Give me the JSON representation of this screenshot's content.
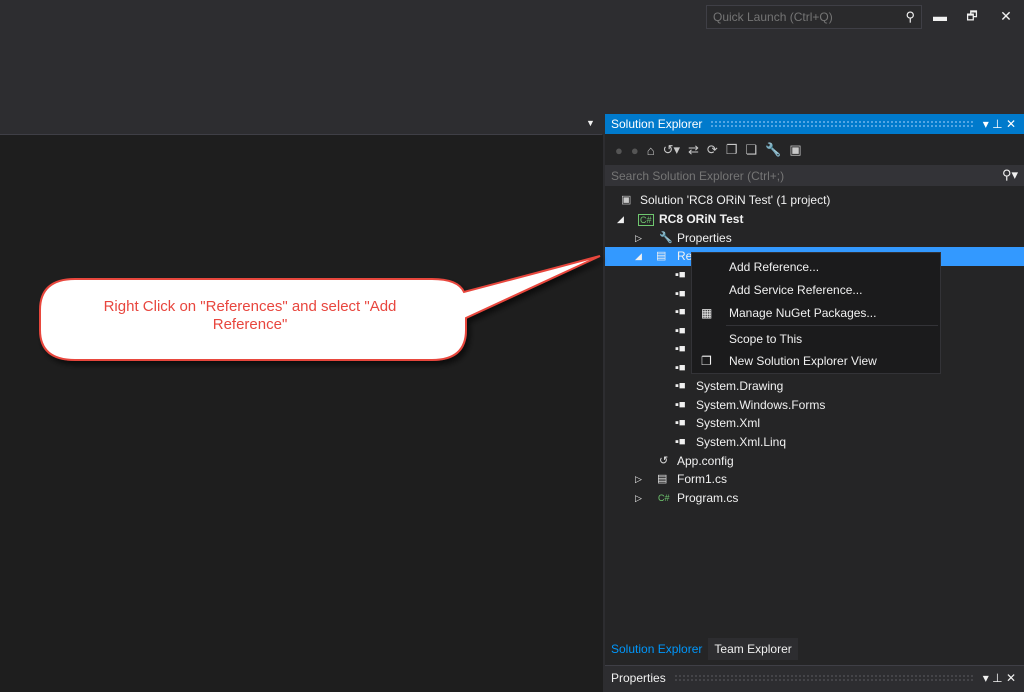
{
  "titlebar": {
    "quick_launch_placeholder": "Quick Launch (Ctrl+Q)",
    "minimize_glyph": "▬",
    "restore_glyph": "🗗",
    "close_glyph": "✕"
  },
  "solution_explorer": {
    "title": "Solution Explorer",
    "title_buttons": "▾ ⊥ ✕",
    "search_placeholder": "Search Solution Explorer (Ctrl+;)",
    "tree": [
      {
        "label": "Solution 'RC8 ORiN Test' (1 project)",
        "icon": "solution-icon"
      },
      {
        "label": "RC8 ORiN Test",
        "icon": "csharp-project-icon",
        "bold": true,
        "expanded": true
      },
      {
        "label": "Properties",
        "icon": "wrench-icon",
        "expanded": false
      },
      {
        "label": "Re",
        "icon": "references-icon",
        "expanded": true,
        "selected": true
      },
      {
        "label": "System.Drawing",
        "icon": "assembly-icon"
      },
      {
        "label": "System.Windows.Forms",
        "icon": "assembly-icon"
      },
      {
        "label": "System.Xml",
        "icon": "assembly-icon"
      },
      {
        "label": "System.Xml.Linq",
        "icon": "assembly-icon"
      },
      {
        "label": "App.config",
        "icon": "config-icon"
      },
      {
        "label": "Form1.cs",
        "icon": "form-icon",
        "expanded": false
      },
      {
        "label": "Program.cs",
        "icon": "csharp-file-icon",
        "expanded": false
      }
    ],
    "tabs": [
      "Solution Explorer",
      "Team Explorer"
    ]
  },
  "properties": {
    "title": "Properties",
    "title_buttons": "▾ ⊥ ✕"
  },
  "context_menu": {
    "items": [
      {
        "label": "Add Reference...",
        "icon": ""
      },
      {
        "label": "Add Service Reference...",
        "icon": ""
      },
      {
        "label": "Manage NuGet Packages...",
        "icon": "nuget-icon"
      },
      {
        "label": "Scope to This",
        "icon": ""
      },
      {
        "label": "New Solution Explorer View",
        "icon": "new-view-icon"
      }
    ]
  },
  "callout": {
    "text": "Right Click on \"References\" and select \"Add Reference\"",
    "color": "#e8463e"
  },
  "colors": {
    "accent": "#007acc",
    "selection": "#3399ff",
    "tab_active": "#0097fb"
  }
}
